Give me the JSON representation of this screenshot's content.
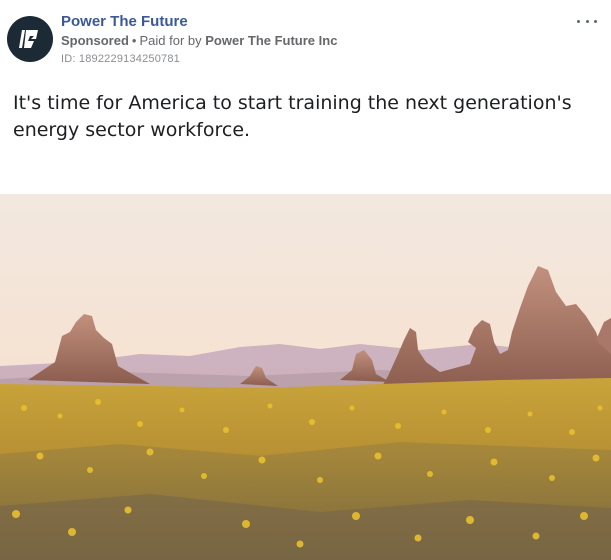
{
  "post": {
    "page_name": "Power The Future",
    "sponsored_label": "Sponsored",
    "separator": "•",
    "paid_for_label": "Paid for by",
    "advertiser": "Power The Future Inc",
    "ad_id": "ID: 1892229134250781",
    "body": "It's time for America to start training the next generation's energy sector workforce.",
    "menu_icon": "more-horizontal-icon",
    "avatar_icon": "power-the-future-logo-icon",
    "image_alt": "desert-landscape-with-rock-spires-and-wildflowers"
  },
  "colors": {
    "page_name": "#3b5998",
    "avatar_bg": "#1c2a36",
    "meta_text": "#65676b",
    "body_text": "#1c1e21"
  }
}
